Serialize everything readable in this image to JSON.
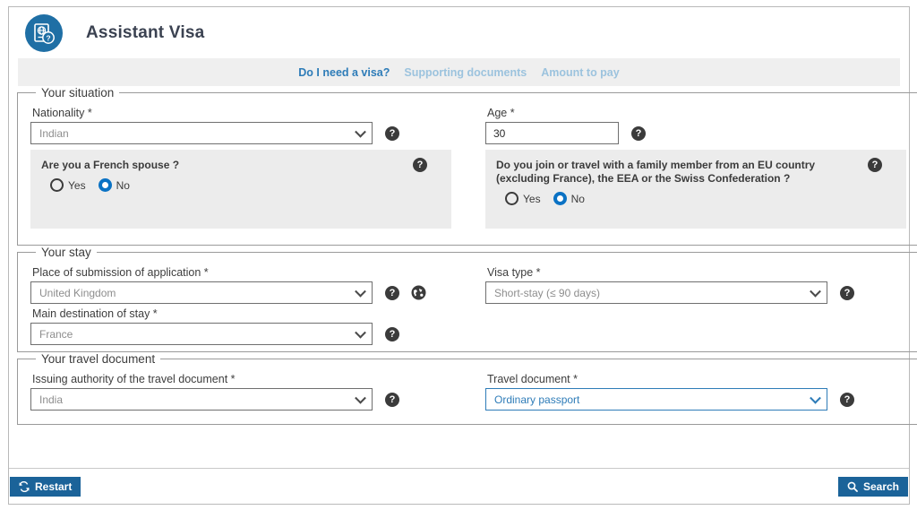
{
  "app": {
    "title": "Assistant Visa",
    "logo_icon": "passport-globe-question-icon",
    "brand_color": "#1f6fa5",
    "accent_color": "#2e7cb8",
    "button_color": "#1b6399"
  },
  "nav": {
    "items": [
      {
        "label": "Do I need a visa?",
        "state": "active"
      },
      {
        "label": "Supporting documents",
        "state": "disabled"
      },
      {
        "label": "Amount to pay",
        "state": "disabled"
      }
    ]
  },
  "sections": {
    "situation": {
      "legend": "Your situation",
      "nationality": {
        "label": "Nationality *",
        "value": "Indian",
        "help_icon": "question-mark-icon"
      },
      "age": {
        "label": "Age *",
        "value": "30",
        "help_icon": "question-mark-icon"
      },
      "french_spouse": {
        "question": "Are you a French spouse ?",
        "help_icon": "question-mark-icon",
        "options": [
          {
            "label": "Yes",
            "selected": false
          },
          {
            "label": "No",
            "selected": true
          }
        ]
      },
      "eu_family": {
        "question": "Do you join or travel with a family member from an EU country (excluding France), the EEA or the Swiss Confederation ?",
        "help_icon": "question-mark-icon",
        "options": [
          {
            "label": "Yes",
            "selected": false
          },
          {
            "label": "No",
            "selected": true
          }
        ]
      }
    },
    "stay": {
      "legend": "Your stay",
      "place_of_submission": {
        "label": "Place of submission of application *",
        "value": "United Kingdom",
        "help_icon": "question-mark-icon",
        "extra_icon": "globe-icon"
      },
      "visa_type": {
        "label": "Visa type *",
        "value": "Short-stay (≤ 90 days)",
        "help_icon": "question-mark-icon"
      },
      "main_destination": {
        "label": "Main destination of stay *",
        "value": "France",
        "help_icon": "question-mark-icon"
      }
    },
    "travel_document": {
      "legend": "Your travel document",
      "issuing_authority": {
        "label": "Issuing authority of the travel document *",
        "value": "India",
        "help_icon": "question-mark-icon"
      },
      "document_type": {
        "label": "Travel document *",
        "value": "Ordinary passport",
        "focused": true,
        "help_icon": "question-mark-icon"
      }
    }
  },
  "footer": {
    "restart": {
      "label": "Restart",
      "icon": "refresh-icon"
    },
    "search": {
      "label": "Search",
      "icon": "search-icon"
    }
  },
  "glyphs": {
    "help": "?"
  }
}
